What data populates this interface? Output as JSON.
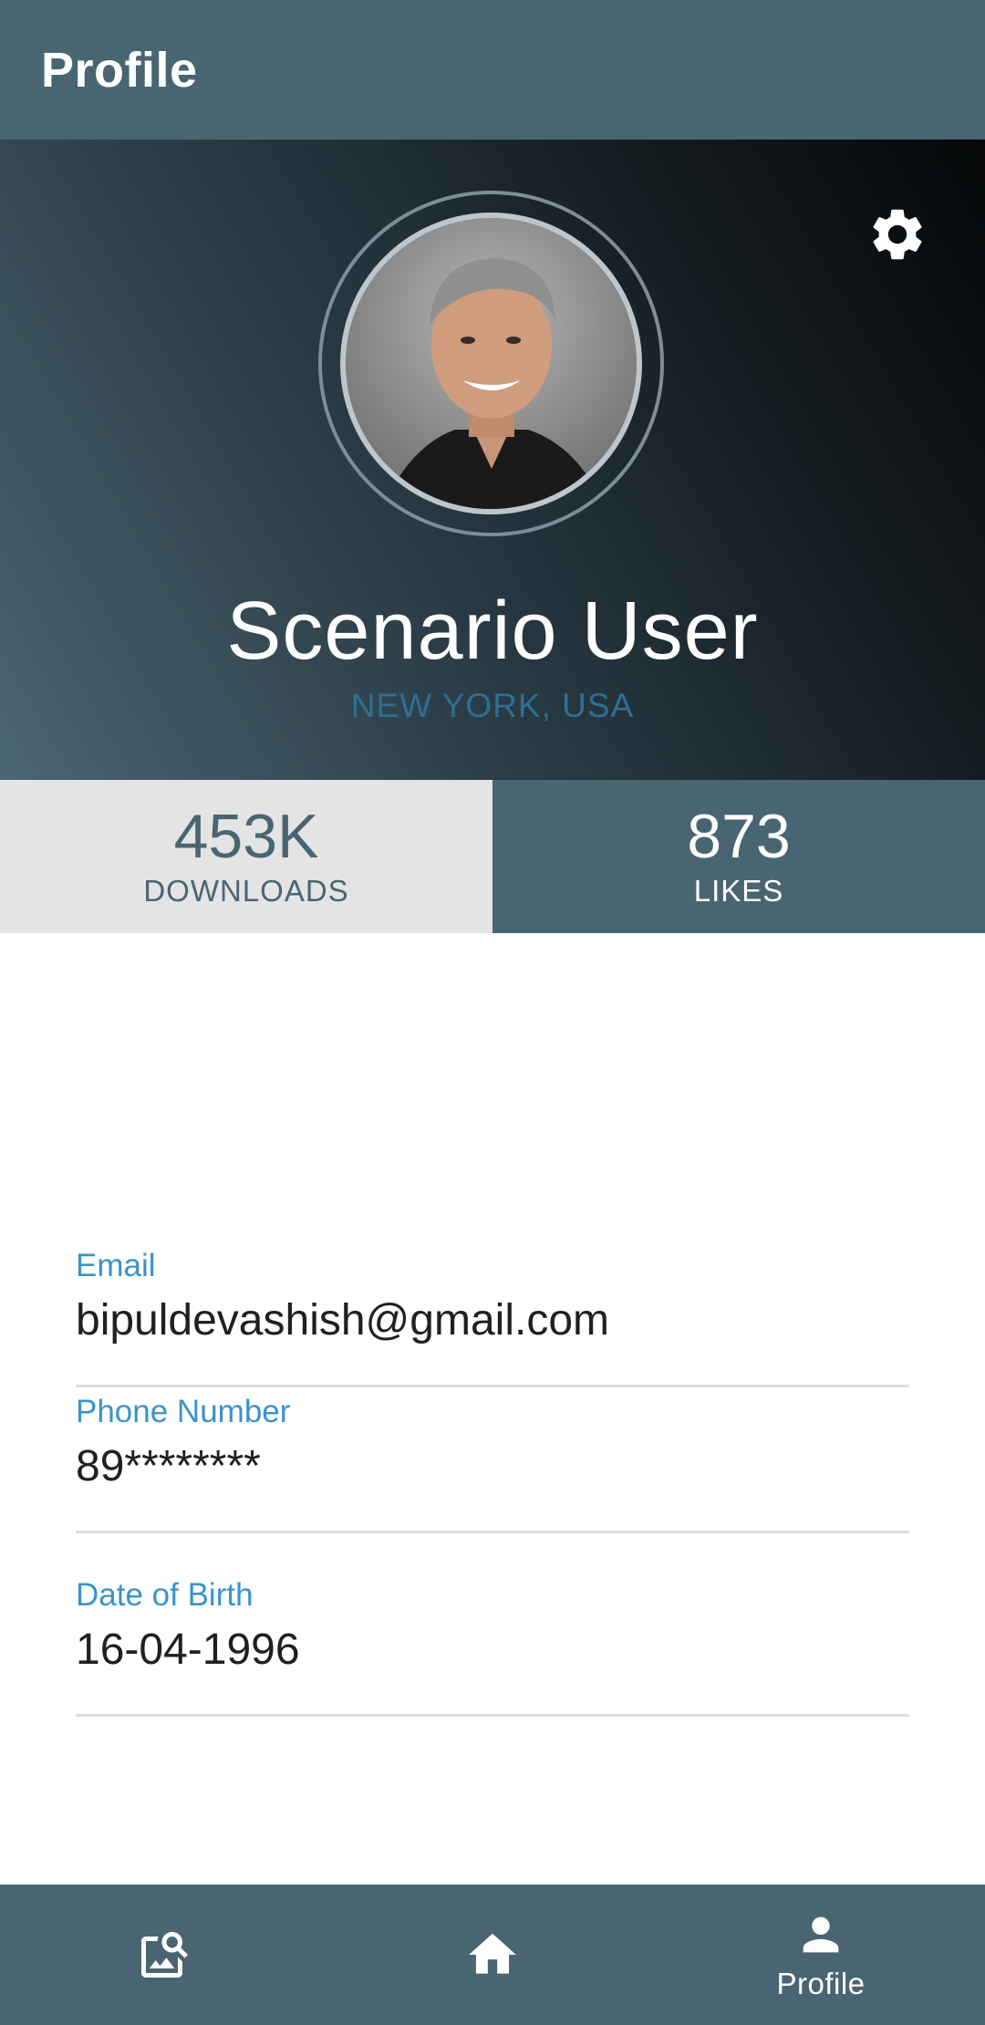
{
  "app_bar": {
    "title": "Profile"
  },
  "hero": {
    "name": "Scenario User",
    "location": "NEW YORK, USA",
    "avatar_alt": "profile photo",
    "settings_icon": "gear-icon"
  },
  "stats": {
    "downloads": {
      "value": "453K",
      "label": "DOWNLOADS"
    },
    "likes": {
      "value": "873",
      "label": "LIKES"
    }
  },
  "fields": {
    "email": {
      "label": "Email",
      "value": "bipuldevashish@gmail.com"
    },
    "phone": {
      "label": "Phone Number",
      "value": "89********"
    },
    "dob": {
      "label": "Date of Birth",
      "value": "16-04-1996"
    }
  },
  "bottom_nav": {
    "items": [
      {
        "icon": "image-search-icon",
        "label": ""
      },
      {
        "icon": "home-icon",
        "label": ""
      },
      {
        "icon": "person-icon",
        "label": "Profile"
      }
    ]
  },
  "colors": {
    "primary": "#4a6572",
    "accent_label": "#3b93c9",
    "location": "#2f6f93",
    "stat_light_bg": "#e4e4e4"
  }
}
